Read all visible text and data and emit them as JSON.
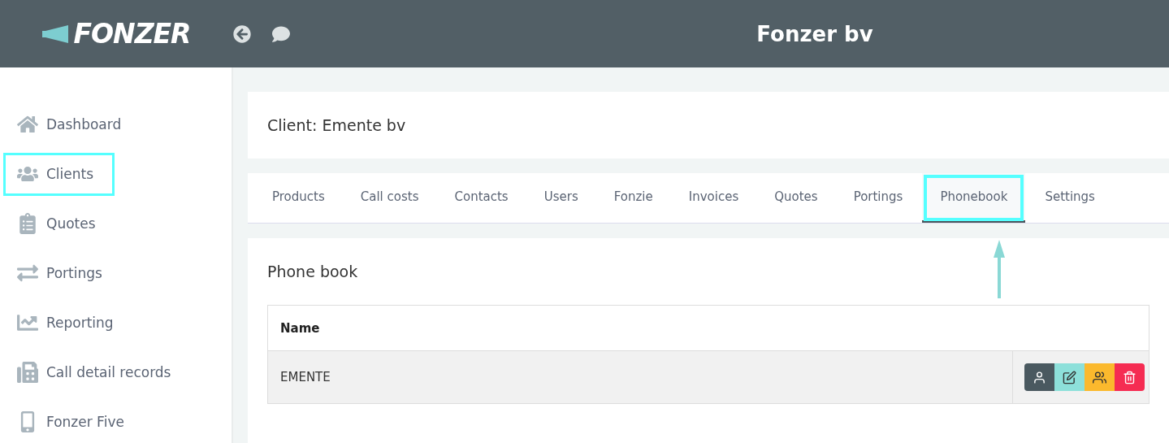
{
  "header": {
    "logo": "FONZER",
    "title": "Fonzer bv"
  },
  "sidebar": {
    "items": [
      {
        "label": "Dashboard",
        "highlighted": false
      },
      {
        "label": "Clients",
        "highlighted": true
      },
      {
        "label": "Quotes",
        "highlighted": false
      },
      {
        "label": "Portings",
        "highlighted": false
      },
      {
        "label": "Reporting",
        "highlighted": false
      },
      {
        "label": "Call detail records",
        "highlighted": false
      },
      {
        "label": "Fonzer Five",
        "highlighted": false
      }
    ]
  },
  "client_title": "Client: Emente bv",
  "tabs": [
    {
      "label": "Products",
      "selected": false,
      "highlighted": false
    },
    {
      "label": "Call costs",
      "selected": false,
      "highlighted": false
    },
    {
      "label": "Contacts",
      "selected": false,
      "highlighted": false
    },
    {
      "label": "Users",
      "selected": false,
      "highlighted": false
    },
    {
      "label": "Fonzie",
      "selected": false,
      "highlighted": false
    },
    {
      "label": "Invoices",
      "selected": false,
      "highlighted": false
    },
    {
      "label": "Quotes",
      "selected": false,
      "highlighted": false
    },
    {
      "label": "Portings",
      "selected": false,
      "highlighted": false
    },
    {
      "label": "Phonebook",
      "selected": true,
      "highlighted": true
    },
    {
      "label": "Settings",
      "selected": false,
      "highlighted": false
    }
  ],
  "phonebook": {
    "title": "Phone book",
    "table": {
      "columns": [
        "Name"
      ],
      "rows": [
        {
          "name": "EMENTE"
        }
      ]
    }
  }
}
